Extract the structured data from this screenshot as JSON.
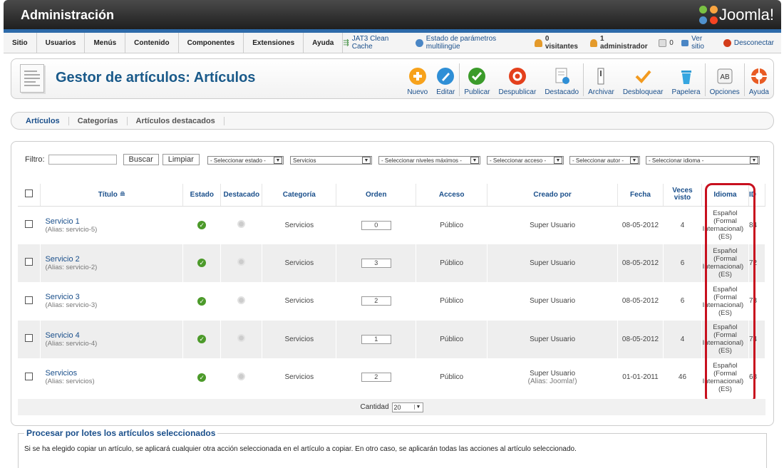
{
  "header": {
    "title": "Administración",
    "logo_text": "Joomla!"
  },
  "menu": {
    "items": [
      "Sitio",
      "Usuarios",
      "Menús",
      "Contenido",
      "Componentes",
      "Extensiones",
      "Ayuda"
    ],
    "status": {
      "cache": "JAT3 Clean Cache",
      "multilang": "Estado de parámetros multilingüe",
      "visitors": "0 visitantes",
      "admins": "1 administrador",
      "messages": "0",
      "view_site": "Ver sitio",
      "logout": "Desconectar"
    }
  },
  "toolbar": {
    "page_title": "Gestor de artículos: Artículos",
    "buttons": [
      "Nuevo",
      "Editar",
      "Publicar",
      "Despublicar",
      "Destacado",
      "Archivar",
      "Desbloquear",
      "Papelera",
      "Opciones",
      "Ayuda"
    ]
  },
  "subnav": {
    "tabs": [
      "Artículos",
      "Categorías",
      "Artículos destacados"
    ]
  },
  "filters": {
    "label": "Filtro:",
    "search_button": "Buscar",
    "clear_button": "Limpiar",
    "state": "- Seleccionar estado -",
    "category": "Servicios",
    "levels": "- Seleccionar niveles máximos -",
    "access": "- Seleccionar acceso -",
    "author": "- Seleccionar autor -",
    "language": "- Seleccionar idioma -"
  },
  "table": {
    "headers": {
      "title": "Título",
      "state": "Estado",
      "featured": "Destacado",
      "category": "Categoría",
      "order": "Orden",
      "access": "Acceso",
      "created_by": "Creado por",
      "date": "Fecha",
      "hits": "Veces visto",
      "language": "Idioma",
      "id": "ID"
    },
    "rows": [
      {
        "title": "Servicio 1",
        "alias": "(Alias: servicio-5)",
        "category": "Servicios",
        "order": "0",
        "access": "Público",
        "author": "Super Usuario",
        "author_alias": "",
        "date": "08-05-2012",
        "hits": "4",
        "lang1": "Español",
        "lang2": "(Formal",
        "lang3": "Internacional)",
        "lang4": "(ES)",
        "id": "84"
      },
      {
        "title": "Servicio 2",
        "alias": "(Alias: servicio-2)",
        "category": "Servicios",
        "order": "3",
        "access": "Público",
        "author": "Super Usuario",
        "author_alias": "",
        "date": "08-05-2012",
        "hits": "6",
        "lang1": "Español",
        "lang2": "(Formal",
        "lang3": "Internacional)",
        "lang4": "(ES)",
        "id": "72"
      },
      {
        "title": "Servicio 3",
        "alias": "(Alias: servicio-3)",
        "category": "Servicios",
        "order": "2",
        "access": "Público",
        "author": "Super Usuario",
        "author_alias": "",
        "date": "08-05-2012",
        "hits": "6",
        "lang1": "Español",
        "lang2": "(Formal",
        "lang3": "Internacional)",
        "lang4": "(ES)",
        "id": "73"
      },
      {
        "title": "Servicio 4",
        "alias": "(Alias: servicio-4)",
        "category": "Servicios",
        "order": "1",
        "access": "Público",
        "author": "Super Usuario",
        "author_alias": "",
        "date": "08-05-2012",
        "hits": "4",
        "lang1": "Español",
        "lang2": "(Formal",
        "lang3": "Internacional)",
        "lang4": "(ES)",
        "id": "74"
      },
      {
        "title": "Servicios",
        "alias": "(Alias: servicios)",
        "category": "Servicios",
        "order": "2",
        "access": "Público",
        "author": "Super Usuario",
        "author_alias": "(Alias: Joomla!)",
        "date": "01-01-2011",
        "hits": "46",
        "lang1": "Español",
        "lang2": "(Formal",
        "lang3": "Internacional)",
        "lang4": "(ES)",
        "id": "68"
      }
    ]
  },
  "footer": {
    "quantity_label": "Cantidad",
    "quantity_value": "20"
  },
  "batch": {
    "legend": "Procesar por lotes los artículos seleccionados",
    "description": "Si se ha elegido copiar un artículo, se aplicará cualquier otra acción seleccionada en el artículo a copiar. En otro caso, se aplicarán todas las acciones al artículo seleccionado."
  },
  "colors": {
    "link": "#1a4f8b",
    "highlight": "#c8101e",
    "header_bar": "#2d6aa9"
  }
}
